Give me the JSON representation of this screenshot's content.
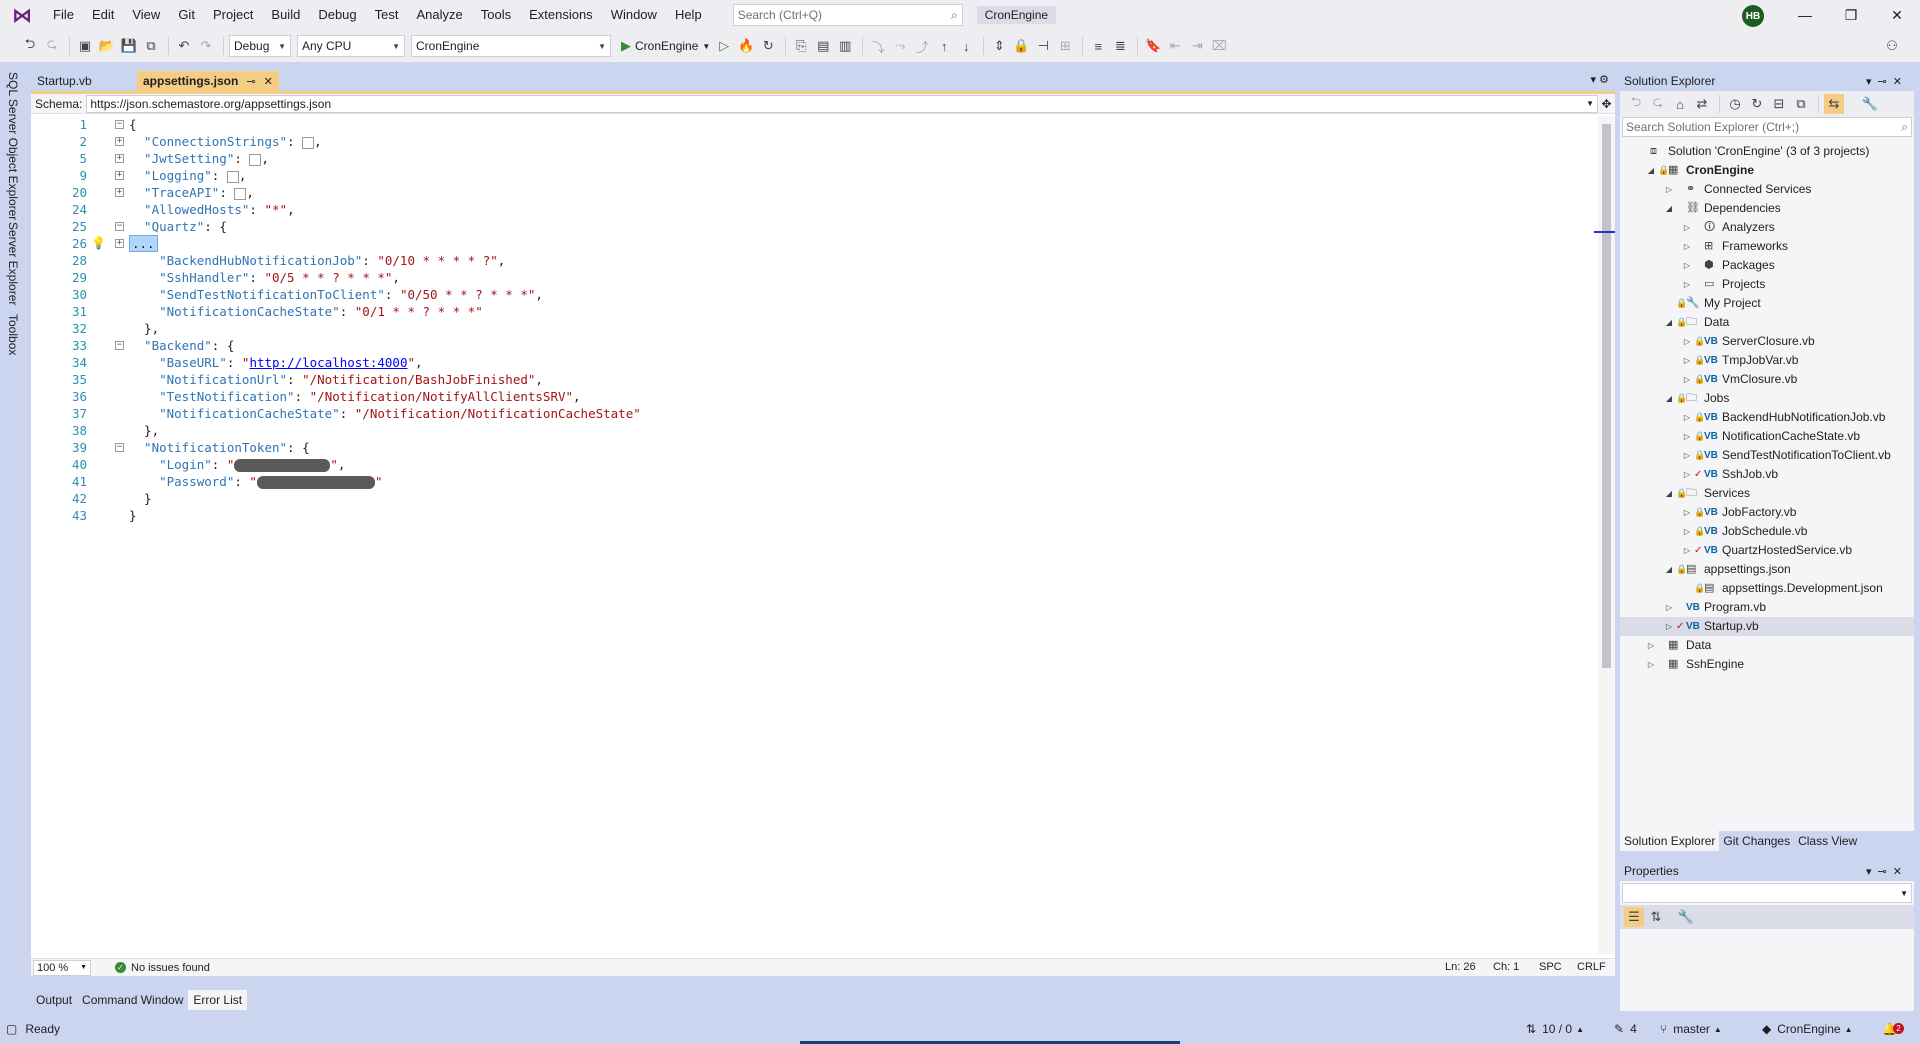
{
  "menu": [
    "File",
    "Edit",
    "View",
    "Git",
    "Project",
    "Build",
    "Debug",
    "Test",
    "Analyze",
    "Tools",
    "Extensions",
    "Window",
    "Help"
  ],
  "global_search": {
    "placeholder": "Search (Ctrl+Q)"
  },
  "solution_name": "CronEngine",
  "user_initials": "HB",
  "toolbar": {
    "configuration": "Debug",
    "platform": "Any CPU",
    "startup_project": "CronEngine",
    "run_label": "CronEngine"
  },
  "left_strip": [
    "SQL Server Object Explorer",
    "Server Explorer",
    "Toolbox"
  ],
  "doc_tabs": [
    {
      "label": "Startup.vb"
    },
    {
      "label": "appsettings.json"
    }
  ],
  "schema": {
    "label": "Schema:",
    "value": "https://json.schemastore.org/appsettings.json"
  },
  "code_lines": [
    {
      "n": "1",
      "fold": "minus",
      "parts": [
        {
          "c": "p",
          "t": "{"
        }
      ]
    },
    {
      "n": "2",
      "fold": "plus",
      "parts": [
        {
          "c": "k",
          "t": "  \"ConnectionStrings\""
        },
        {
          "c": "p",
          "t": ": "
        },
        {
          "c": "box"
        },
        {
          "c": "p",
          "t": ","
        }
      ]
    },
    {
      "n": "5",
      "fold": "plus",
      "parts": [
        {
          "c": "k",
          "t": "  \"JwtSetting\""
        },
        {
          "c": "p",
          "t": ": "
        },
        {
          "c": "box"
        },
        {
          "c": "p",
          "t": ","
        }
      ]
    },
    {
      "n": "9",
      "fold": "plus",
      "parts": [
        {
          "c": "k",
          "t": "  \"Logging\""
        },
        {
          "c": "p",
          "t": ": "
        },
        {
          "c": "box"
        },
        {
          "c": "p",
          "t": ","
        }
      ]
    },
    {
      "n": "20",
      "fold": "plus",
      "parts": [
        {
          "c": "k",
          "t": "  \"TraceAPI\""
        },
        {
          "c": "p",
          "t": ": "
        },
        {
          "c": "box"
        },
        {
          "c": "p",
          "t": ","
        }
      ]
    },
    {
      "n": "24",
      "fold": "",
      "parts": [
        {
          "c": "k",
          "t": "  \"AllowedHosts\""
        },
        {
          "c": "p",
          "t": ": "
        },
        {
          "c": "s",
          "t": "\"*\""
        },
        {
          "c": "p",
          "t": ","
        }
      ]
    },
    {
      "n": "25",
      "fold": "minus",
      "parts": [
        {
          "c": "k",
          "t": "  \"Quartz\""
        },
        {
          "c": "p",
          "t": ": {"
        }
      ]
    },
    {
      "n": "26",
      "fold": "plus",
      "bulb": true,
      "parts": [
        {
          "c": "sel",
          "t": "..."
        }
      ]
    },
    {
      "n": "28",
      "fold": "",
      "parts": [
        {
          "c": "k",
          "t": "    \"BackendHubNotificationJob\""
        },
        {
          "c": "p",
          "t": ": "
        },
        {
          "c": "s",
          "t": "\"0/10 * * * * ?\""
        },
        {
          "c": "p",
          "t": ","
        }
      ]
    },
    {
      "n": "29",
      "fold": "",
      "parts": [
        {
          "c": "k",
          "t": "    \"SshHandler\""
        },
        {
          "c": "p",
          "t": ": "
        },
        {
          "c": "s",
          "t": "\"0/5 * * ? * * *\""
        },
        {
          "c": "p",
          "t": ","
        }
      ]
    },
    {
      "n": "30",
      "fold": "",
      "parts": [
        {
          "c": "k",
          "t": "    \"SendTestNotificationToClient\""
        },
        {
          "c": "p",
          "t": ": "
        },
        {
          "c": "s",
          "t": "\"0/50 * * ? * * *\""
        },
        {
          "c": "p",
          "t": ","
        }
      ]
    },
    {
      "n": "31",
      "fold": "",
      "parts": [
        {
          "c": "k",
          "t": "    \"NotificationCacheState\""
        },
        {
          "c": "p",
          "t": ": "
        },
        {
          "c": "s",
          "t": "\"0/1 * * ? * * *\""
        }
      ]
    },
    {
      "n": "32",
      "fold": "",
      "parts": [
        {
          "c": "p",
          "t": "  },"
        }
      ]
    },
    {
      "n": "33",
      "fold": "minus",
      "parts": [
        {
          "c": "k",
          "t": "  \"Backend\""
        },
        {
          "c": "p",
          "t": ": {"
        }
      ]
    },
    {
      "n": "34",
      "fold": "",
      "parts": [
        {
          "c": "k",
          "t": "    \"BaseURL\""
        },
        {
          "c": "p",
          "t": ": "
        },
        {
          "c": "s",
          "t": "\""
        },
        {
          "c": "link",
          "t": "http://localhost:4000"
        },
        {
          "c": "s",
          "t": "\""
        },
        {
          "c": "p",
          "t": ","
        }
      ]
    },
    {
      "n": "35",
      "fold": "",
      "parts": [
        {
          "c": "k",
          "t": "    \"NotificationUrl\""
        },
        {
          "c": "p",
          "t": ": "
        },
        {
          "c": "s",
          "t": "\"/Notification/BashJobFinished\""
        },
        {
          "c": "p",
          "t": ","
        }
      ]
    },
    {
      "n": "36",
      "fold": "",
      "parts": [
        {
          "c": "k",
          "t": "    \"TestNotification\""
        },
        {
          "c": "p",
          "t": ": "
        },
        {
          "c": "s",
          "t": "\"/Notification/NotifyAllClientsSRV\""
        },
        {
          "c": "p",
          "t": ","
        }
      ]
    },
    {
      "n": "37",
      "fold": "",
      "parts": [
        {
          "c": "k",
          "t": "    \"NotificationCacheState\""
        },
        {
          "c": "p",
          "t": ": "
        },
        {
          "c": "s",
          "t": "\"/Notification/NotificationCacheState\""
        }
      ]
    },
    {
      "n": "38",
      "fold": "",
      "parts": [
        {
          "c": "p",
          "t": "  },"
        }
      ]
    },
    {
      "n": "39",
      "fold": "minus",
      "parts": [
        {
          "c": "k",
          "t": "  \"NotificationToken\""
        },
        {
          "c": "p",
          "t": ": {"
        }
      ]
    },
    {
      "n": "40",
      "fold": "",
      "parts": [
        {
          "c": "k",
          "t": "    \"Login\""
        },
        {
          "c": "p",
          "t": ": "
        },
        {
          "c": "s",
          "t": "\""
        },
        {
          "c": "redact"
        },
        {
          "c": "s",
          "t": "\""
        },
        {
          "c": "p",
          "t": ","
        }
      ]
    },
    {
      "n": "41",
      "fold": "",
      "parts": [
        {
          "c": "k",
          "t": "    \"Password\""
        },
        {
          "c": "p",
          "t": ": "
        },
        {
          "c": "s",
          "t": "\""
        },
        {
          "c": "redact-wide"
        },
        {
          "c": "s",
          "t": "\""
        }
      ]
    },
    {
      "n": "42",
      "fold": "",
      "parts": [
        {
          "c": "p",
          "t": "  }"
        }
      ]
    },
    {
      "n": "43",
      "fold": "",
      "parts": [
        {
          "c": "p",
          "t": "}"
        }
      ]
    }
  ],
  "editor_status": {
    "zoom": "100 %",
    "issues": "No issues found",
    "line": "Ln: 26",
    "col": "Ch: 1",
    "whitespace": "SPC",
    "line_ending": "CRLF"
  },
  "bottom_tabs": [
    "Output",
    "Command Window",
    "Error List"
  ],
  "solution_explorer": {
    "title": "Solution Explorer",
    "search_placeholder": "Search Solution Explorer (Ctrl+;)",
    "tree": [
      {
        "label": "Solution 'CronEngine' (3 of 3 projects)",
        "level": 0,
        "expander": "",
        "icon": "solution",
        "bold": false
      },
      {
        "label": "CronEngine",
        "level": 1,
        "expander": "open",
        "icon": "project",
        "bold": true,
        "lock": true
      },
      {
        "label": "Connected Services",
        "level": 2,
        "expander": "closed",
        "icon": "connected"
      },
      {
        "label": "Dependencies",
        "level": 2,
        "expander": "open",
        "icon": "deps"
      },
      {
        "label": "Analyzers",
        "level": 3,
        "expander": "closed",
        "icon": "analyzer"
      },
      {
        "label": "Frameworks",
        "level": 3,
        "expander": "closed",
        "icon": "framework"
      },
      {
        "label": "Packages",
        "level": 3,
        "expander": "closed",
        "icon": "package"
      },
      {
        "label": "Projects",
        "level": 3,
        "expander": "closed",
        "icon": "projects"
      },
      {
        "label": "My Project",
        "level": 2,
        "expander": "",
        "icon": "myproject",
        "lock": true
      },
      {
        "label": "Data",
        "level": 2,
        "expander": "open",
        "icon": "folder",
        "lock": true
      },
      {
        "label": "ServerClosure.vb",
        "level": 3,
        "expander": "closed",
        "icon": "vb",
        "lock": true
      },
      {
        "label": "TmpJobVar.vb",
        "level": 3,
        "expander": "closed",
        "icon": "vb",
        "lock": true
      },
      {
        "label": "VmClosure.vb",
        "level": 3,
        "expander": "closed",
        "icon": "vb",
        "lock": true
      },
      {
        "label": "Jobs",
        "level": 2,
        "expander": "open",
        "icon": "folder",
        "lock": true
      },
      {
        "label": "BackendHubNotificationJob.vb",
        "level": 3,
        "expander": "closed",
        "icon": "vb",
        "lock": true
      },
      {
        "label": "NotificationCacheState.vb",
        "level": 3,
        "expander": "closed",
        "icon": "vb",
        "lock": true
      },
      {
        "label": "SendTestNotificationToClient.vb",
        "level": 3,
        "expander": "closed",
        "icon": "vb",
        "lock": true
      },
      {
        "label": "SshJob.vb",
        "level": 3,
        "expander": "closed",
        "icon": "vb",
        "check": true
      },
      {
        "label": "Services",
        "level": 2,
        "expander": "open",
        "icon": "folder",
        "lock": true
      },
      {
        "label": "JobFactory.vb",
        "level": 3,
        "expander": "closed",
        "icon": "vb",
        "lock": true
      },
      {
        "label": "JobSchedule.vb",
        "level": 3,
        "expander": "closed",
        "icon": "vb",
        "lock": true
      },
      {
        "label": "QuartzHostedService.vb",
        "level": 3,
        "expander": "closed",
        "icon": "vb",
        "check": true
      },
      {
        "label": "appsettings.json",
        "level": 2,
        "expander": "open",
        "icon": "json",
        "lock": true
      },
      {
        "label": "appsettings.Development.json",
        "level": 3,
        "expander": "",
        "icon": "json",
        "lock": true
      },
      {
        "label": "Program.vb",
        "level": 2,
        "expander": "closed",
        "icon": "vb"
      },
      {
        "label": "Startup.vb",
        "level": 2,
        "expander": "closed",
        "icon": "vb",
        "check": true,
        "selected": true
      },
      {
        "label": "Data",
        "level": 1,
        "expander": "closed",
        "icon": "project"
      },
      {
        "label": "SshEngine",
        "level": 1,
        "expander": "closed",
        "icon": "vbproject"
      }
    ],
    "tabs": [
      "Solution Explorer",
      "Git Changes",
      "Class View"
    ]
  },
  "properties": {
    "title": "Properties"
  },
  "statusbar": {
    "ready": "Ready",
    "commits": "10 / 0",
    "changes": "4",
    "branch": "master",
    "repo": "CronEngine",
    "notifications": "2"
  },
  "colors": {
    "accent": "#68217a",
    "active_tab": "#f5cc84",
    "chrome": "#ccd5f0",
    "keyword": "#2e75b6",
    "string": "#a31515",
    "line_number": "#2b91af"
  }
}
